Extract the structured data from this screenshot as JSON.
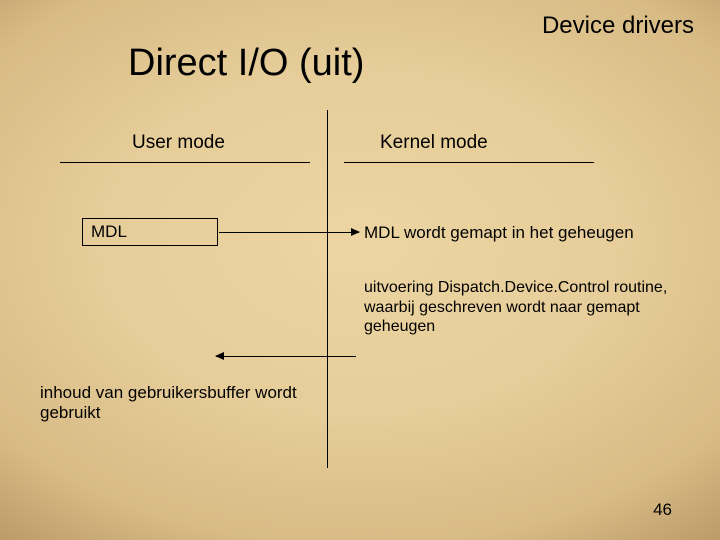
{
  "header": {
    "title": "Device drivers"
  },
  "slide": {
    "title": "Direct I/O (uit)"
  },
  "columns": {
    "user_label": "User mode",
    "kernel_label": "Kernel mode"
  },
  "mdl": {
    "box_label": "MDL"
  },
  "kernel_side": {
    "mapped_text": "MDL wordt gemapt in het geheugen",
    "dispatch_text": "uitvoering Dispatch.Device.Control routine, waarbij geschreven wordt naar gemapt geheugen"
  },
  "user_side": {
    "buffer_text": "inhoud van gebruikersbuffer wordt gebruikt"
  },
  "page_number": "46"
}
